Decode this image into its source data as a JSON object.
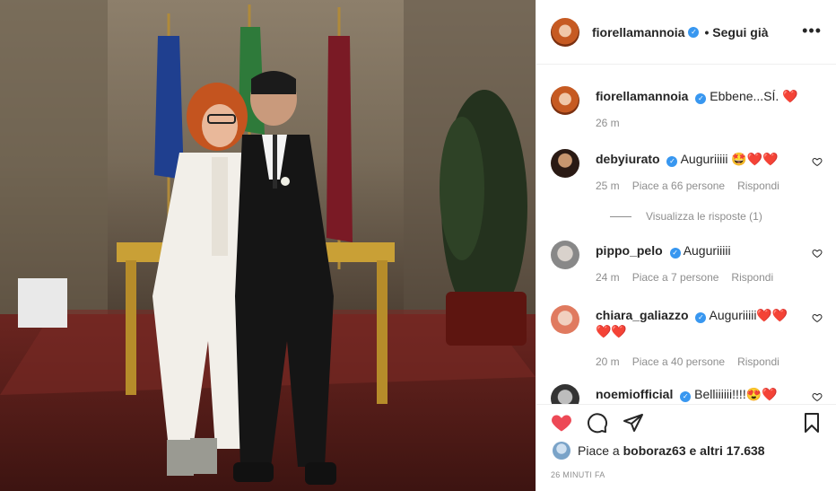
{
  "post": {
    "author": "fiorellamannoia",
    "follow_status": "Segui già",
    "more_icon": "more-horizontal-icon",
    "caption": "Ebbene...SÍ.",
    "caption_time": "26 m"
  },
  "comments": [
    {
      "user": "debyiurato",
      "text": "Auguriiiii 🤩❤️❤️",
      "time": "25 m",
      "likes": "Piace a 66 persone",
      "reply": "Rispondi",
      "view_replies": "Visualizza le risposte (1)"
    },
    {
      "user": "pippo_pelo",
      "text": "Auguriiiii",
      "time": "24 m",
      "likes": "Piace a 7 persone",
      "reply": "Rispondi"
    },
    {
      "user": "chiara_galiazzo",
      "text": "Auguriiiii❤️❤️❤️❤️",
      "time": "20 m",
      "likes": "Piace a 40 persone",
      "reply": "Rispondi"
    },
    {
      "user": "noemiofficial",
      "text": "Belliiiiii!!!!😍❤️"
    }
  ],
  "actions": {
    "like_icon": "heart-filled-icon",
    "comment_icon": "comment-icon",
    "share_icon": "share-icon",
    "save_icon": "bookmark-icon",
    "liked_by_prefix": "Piace a",
    "liked_by_user": "boboraz63",
    "liked_by_suffix": "e altri 17.638",
    "timestamp": "26 MINUTI FA"
  },
  "colors": {
    "like": "#ed4956",
    "verified": "#3897f0",
    "muted": "#8e8e8e"
  }
}
